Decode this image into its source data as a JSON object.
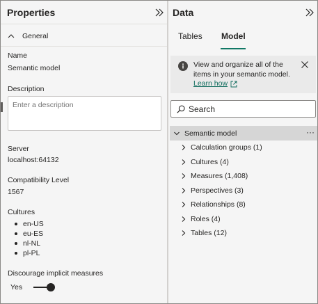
{
  "properties": {
    "title": "Properties",
    "section": "General",
    "name_label": "Name",
    "name_value": "Semantic model",
    "description_label": "Description",
    "description_placeholder": "Enter a description",
    "server_label": "Server",
    "server_value": "localhost:64132",
    "compat_label": "Compatibility Level",
    "compat_value": "1567",
    "cultures_label": "Cultures",
    "cultures": [
      "en-US",
      "eu-ES",
      "nl-NL",
      "pl-PL"
    ],
    "implicit_label": "Discourage implicit measures",
    "implicit_value": "Yes",
    "implicit_on": true
  },
  "data": {
    "title": "Data",
    "tabs": [
      {
        "label": "Tables",
        "active": false
      },
      {
        "label": "Model",
        "active": true
      }
    ],
    "info": {
      "text": "View and organize all of the items in your semantic model.",
      "link": "Learn how"
    },
    "search_placeholder": "Search",
    "tree": {
      "root": "Semantic model",
      "more": "···",
      "items": [
        "Calculation groups (1)",
        "Cultures (4)",
        "Measures (1,408)",
        "Perspectives (3)",
        "Relationships (8)",
        "Roles (4)",
        "Tables (12)"
      ]
    }
  },
  "colors": {
    "accent": "#117865",
    "link": "#0f6c5d",
    "pane_bg": "#f5f5f5"
  },
  "icons": {
    "collapse": "double-chevron-right-icon",
    "info": "info-icon",
    "close": "close-icon",
    "search": "search-icon",
    "external": "open-external-icon"
  }
}
